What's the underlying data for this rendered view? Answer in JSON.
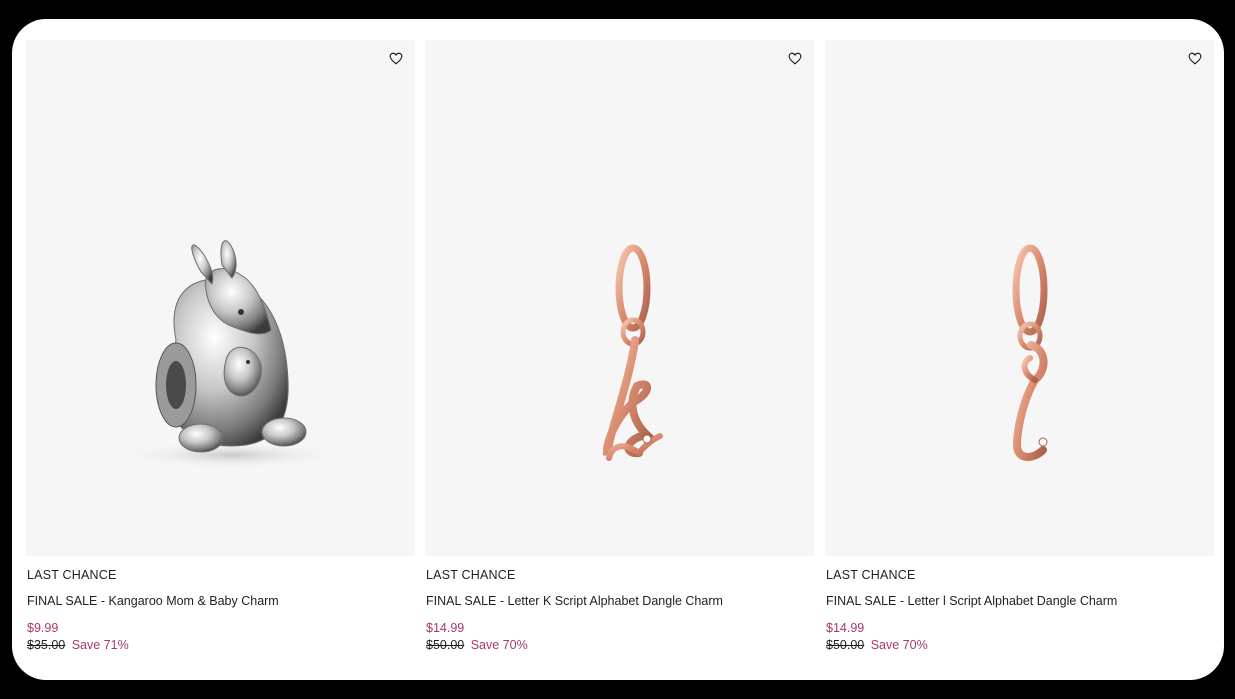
{
  "products": [
    {
      "badge": "LAST CHANCE",
      "title": "FINAL SALE - Kangaroo Mom & Baby Charm",
      "price_now": "$9.99",
      "price_was": "$35.00",
      "save": "Save 71%",
      "image": "kangaroo-charm-silver"
    },
    {
      "badge": "LAST CHANCE",
      "title": "FINAL SALE - Letter K Script Alphabet Dangle Charm",
      "price_now": "$14.99",
      "price_was": "$50.00",
      "save": "Save 70%",
      "image": "letter-k-charm-rose-gold"
    },
    {
      "badge": "LAST CHANCE",
      "title": "FINAL SALE - Letter l Script Alphabet Dangle Charm",
      "price_now": "$14.99",
      "price_was": "$50.00",
      "save": "Save 70%",
      "image": "letter-l-charm-rose-gold"
    }
  ],
  "icons": {
    "wishlist": "heart-outline-icon"
  },
  "colors": {
    "sale_price": "#a8386d",
    "image_bg": "#f6f6f6",
    "text": "#1f1f1f",
    "rose_gold": "#d9957c",
    "silver": "#c9c9c9"
  }
}
